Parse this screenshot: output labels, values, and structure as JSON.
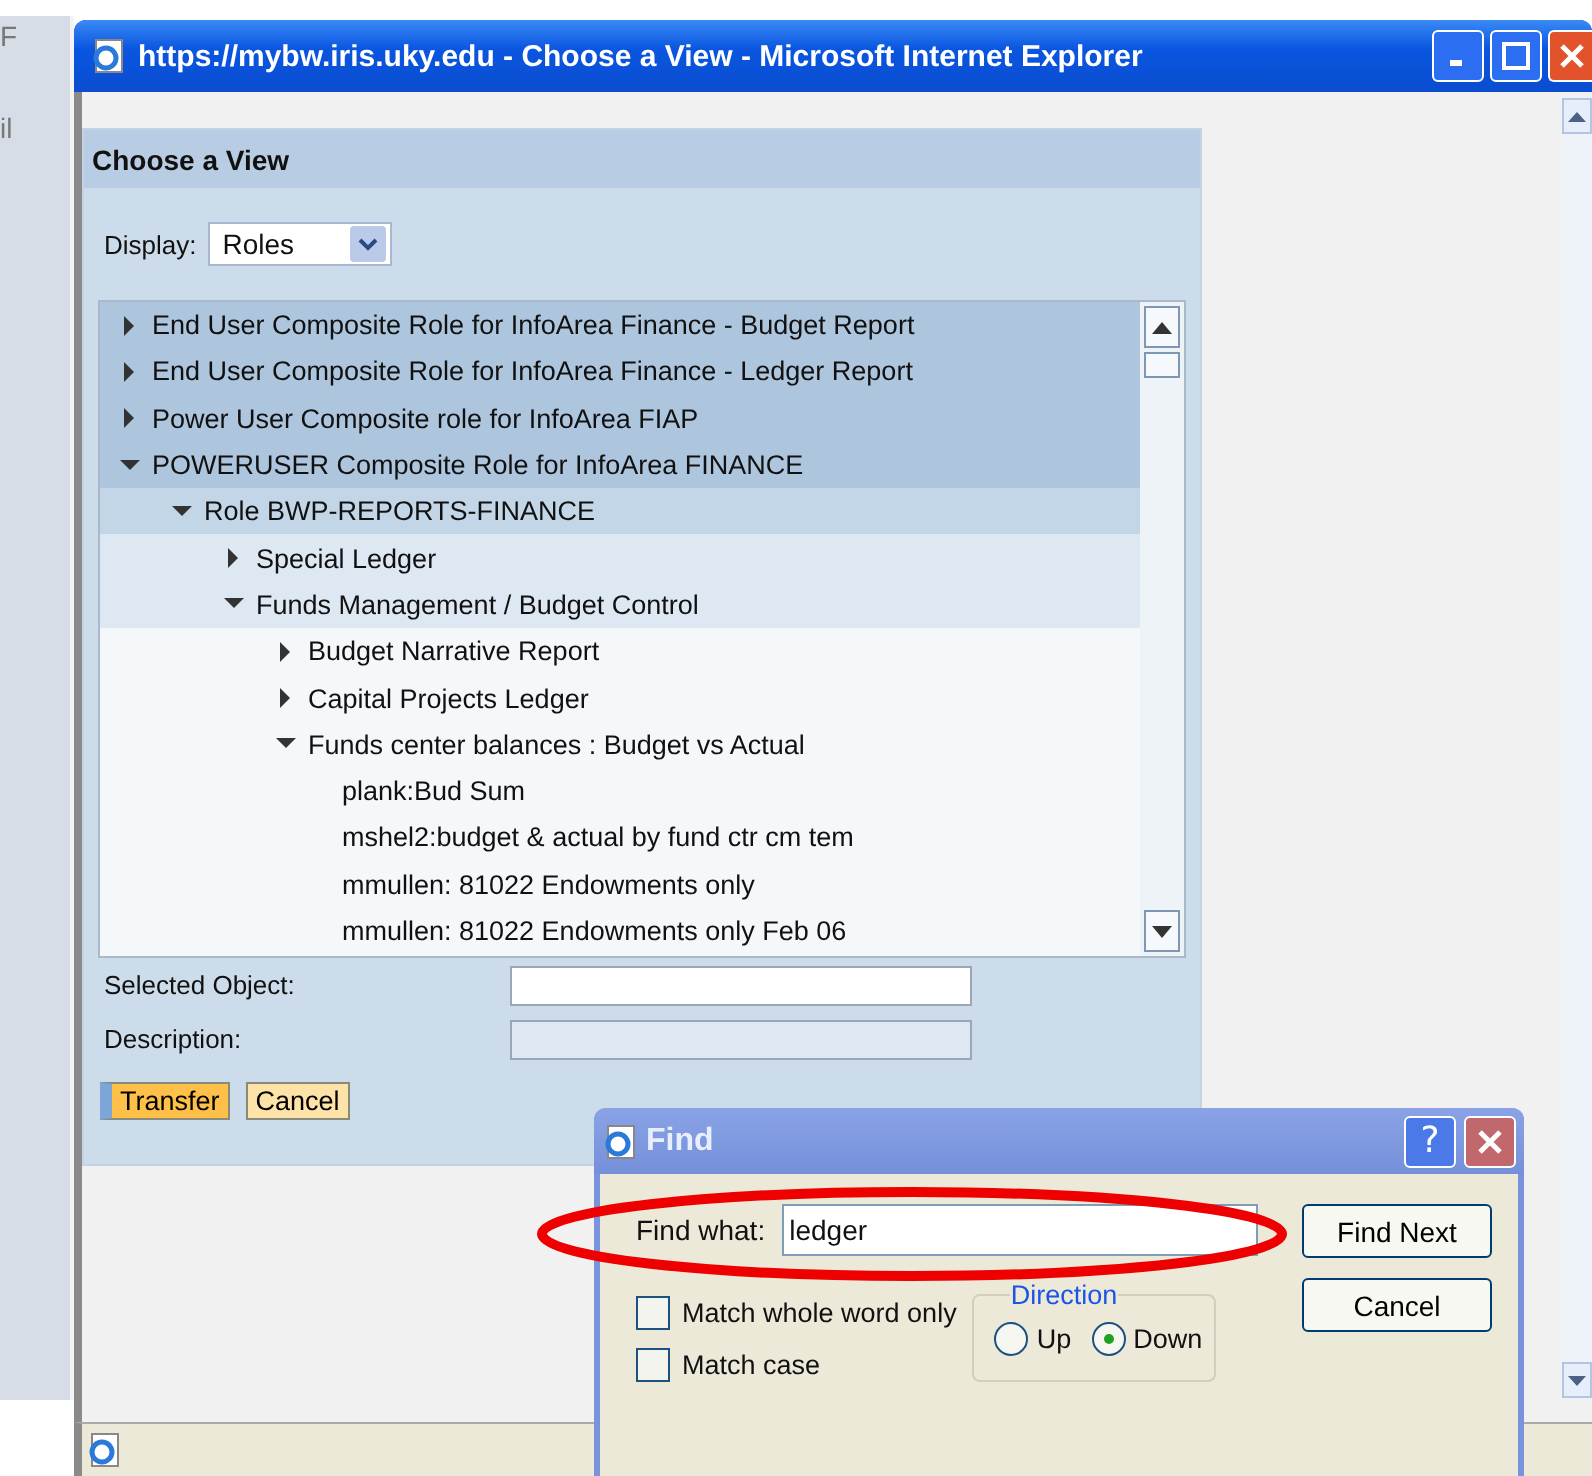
{
  "behind_window": {
    "fragments": [
      "F",
      "il"
    ]
  },
  "window": {
    "title": "https://mybw.iris.uky.edu - Choose a View - Microsoft Internet Explorer"
  },
  "panel": {
    "title": "Choose a View",
    "display_label": "Display:",
    "display_value": "Roles",
    "tree": [
      {
        "label": "End User Composite Role for InfoArea Finance - Budget Report",
        "kind": "node",
        "expanded": false
      },
      {
        "label": "End User Composite Role for InfoArea Finance - Ledger Report",
        "kind": "node",
        "expanded": false
      },
      {
        "label": "Power User Composite role for InfoArea FIAP",
        "kind": "node",
        "expanded": false
      },
      {
        "label": "POWERUSER Composite Role for InfoArea FINANCE",
        "kind": "node",
        "expanded": true,
        "children": [
          {
            "label": "Role BWP-REPORTS-FINANCE",
            "kind": "node",
            "expanded": true,
            "children": [
              {
                "label": "Special Ledger",
                "kind": "node",
                "expanded": false
              },
              {
                "label": "Funds Management / Budget Control",
                "kind": "node",
                "expanded": true,
                "children": [
                  {
                    "label": "Budget Narrative Report",
                    "kind": "node",
                    "expanded": false
                  },
                  {
                    "label": "Capital Projects Ledger",
                    "kind": "node",
                    "expanded": false
                  },
                  {
                    "label": "Funds center balances : Budget vs Actual",
                    "kind": "node",
                    "expanded": true,
                    "children": [
                      {
                        "label": "plank:Bud Sum",
                        "kind": "leaf"
                      },
                      {
                        "label": "mshel2:budget & actual by fund ctr cm tem",
                        "kind": "leaf"
                      },
                      {
                        "label": "mmullen: 81022 Endowments only",
                        "kind": "leaf"
                      },
                      {
                        "label": "mmullen: 81022 Endowments only Feb 06",
                        "kind": "leaf"
                      }
                    ]
                  }
                ]
              }
            ]
          }
        ]
      }
    ],
    "selected_object_label": "Selected Object:",
    "description_label": "Description:",
    "buttons": [
      {
        "label": "Transfer",
        "kind": "primary"
      },
      {
        "label": "Cancel",
        "kind": "secondary"
      }
    ]
  },
  "find_dialog": {
    "title": "Find",
    "find_what_label": "Find what:",
    "find_what_value": "ledger",
    "highlighted": true,
    "options": [
      {
        "label": "Match whole word only",
        "checked": false
      },
      {
        "label": "Match case",
        "checked": false
      }
    ],
    "direction_label": "Direction",
    "direction": [
      {
        "label": "Up",
        "selected": false
      },
      {
        "label": "Down",
        "selected": true
      }
    ],
    "buttons": [
      "Find Next",
      "Cancel"
    ],
    "help": "?"
  }
}
